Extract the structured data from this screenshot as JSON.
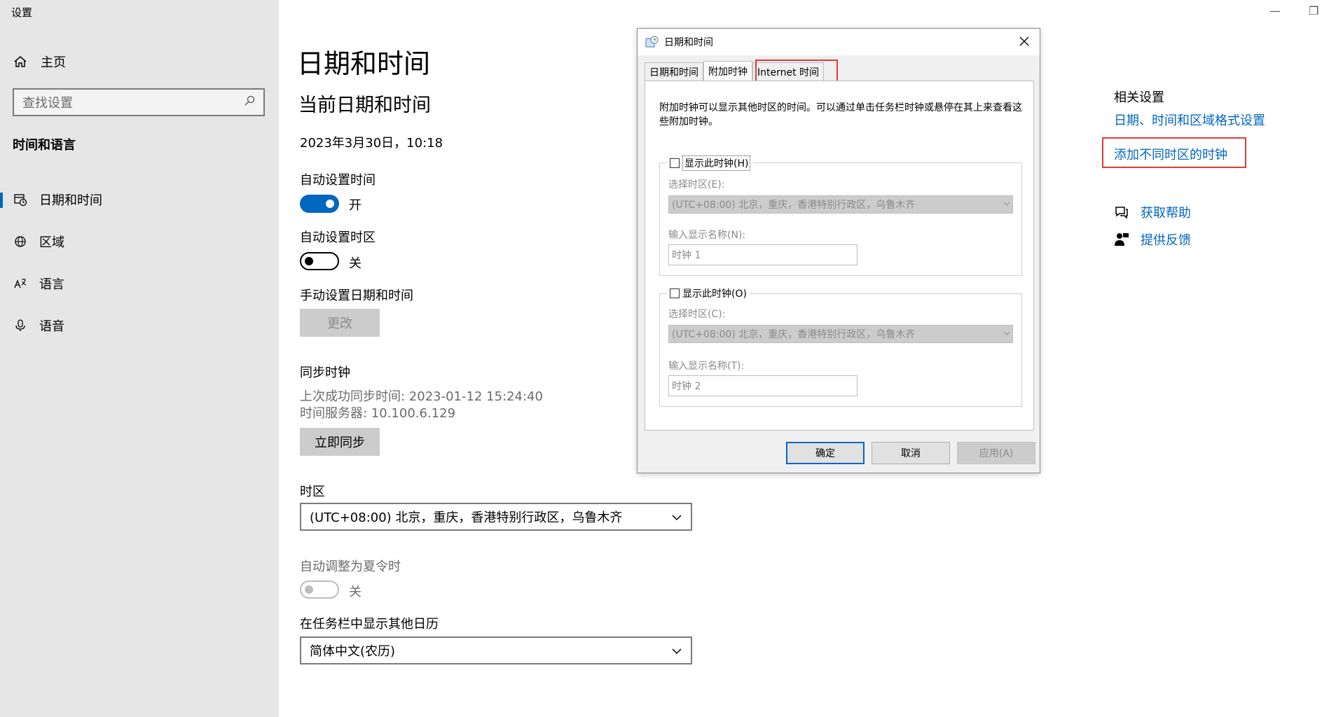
{
  "window": {
    "title": "设置",
    "minimize": "—",
    "restore": "❐"
  },
  "sidebar": {
    "home": "主页",
    "search_placeholder": "查找设置",
    "section_title": "时间和语言",
    "items": [
      {
        "label": "日期和时间",
        "icon": "calendar-clock-icon"
      },
      {
        "label": "区域",
        "icon": "globe-icon"
      },
      {
        "label": "语言",
        "icon": "language-icon"
      },
      {
        "label": "语音",
        "icon": "microphone-icon"
      }
    ]
  },
  "main": {
    "title": "日期和时间",
    "current_title": "当前日期和时间",
    "current_datetime": "2023年3月30日，10:18",
    "auto_time": {
      "label": "自动设置时间",
      "state": "开"
    },
    "auto_timezone": {
      "label": "自动设置时区",
      "state": "关"
    },
    "manual": {
      "label": "手动设置日期和时间",
      "button": "更改"
    },
    "sync": {
      "title": "同步时钟",
      "last_sync": "上次成功同步时间: 2023-01-12 15:24:40",
      "server": "时间服务器: 10.100.6.129",
      "button": "立即同步"
    },
    "timezone": {
      "label": "时区",
      "value": "(UTC+08:00) 北京，重庆，香港特别行政区，乌鲁木齐"
    },
    "dst": {
      "label": "自动调整为夏令时",
      "state": "关"
    },
    "calendar": {
      "label": "在任务栏中显示其他日历",
      "value": "简体中文(农历)"
    }
  },
  "related": {
    "title": "相关设置",
    "link1": "日期、时间和区域格式设置",
    "link2": "添加不同时区的时钟",
    "help": "获取帮助",
    "feedback": "提供反馈"
  },
  "dialog": {
    "title": "日期和时间",
    "tabs": [
      "日期和时间",
      "附加时钟",
      "Internet 时间"
    ],
    "description": "附加时钟可以显示其他时区的时间。可以通过单击任务栏时钟或悬停在其上来查看这些附加时钟。",
    "clock1": {
      "checkbox": "显示此时钟(H)",
      "tz_label": "选择时区(E):",
      "tz_value": "(UTC+08:00) 北京，重庆，香港特别行政区，乌鲁木齐",
      "name_label": "输入显示名称(N):",
      "name_value": "时钟 1"
    },
    "clock2": {
      "checkbox": "显示此时钟(O)",
      "tz_label": "选择时区(C):",
      "tz_value": "(UTC+08:00) 北京，重庆，香港特别行政区，乌鲁木齐",
      "name_label": "输入显示名称(T):",
      "name_value": "时钟 2"
    },
    "buttons": {
      "ok": "确定",
      "cancel": "取消",
      "apply": "应用(A)"
    }
  },
  "colors": {
    "accent": "#0067c0",
    "highlight_box": "#e53935",
    "sidebar_bg": "#e6e6e6"
  }
}
